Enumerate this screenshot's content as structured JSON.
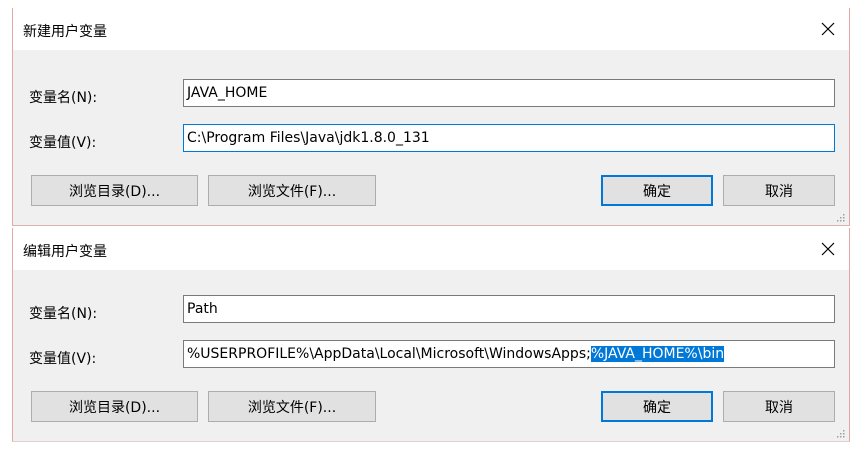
{
  "dialogs": [
    {
      "title": "新建用户变量",
      "name_label": "变量名(N):",
      "name_value": "JAVA_HOME",
      "value_label": "变量值(V):",
      "value_text": "C:\\Program Files\\Java\\jdk1.8.0_131",
      "value_selected": "",
      "browse_dir_label": "浏览目录(D)...",
      "browse_file_label": "浏览文件(F)...",
      "ok_label": "确定",
      "cancel_label": "取消"
    },
    {
      "title": "编辑用户变量",
      "name_label": "变量名(N):",
      "name_value": "Path",
      "value_label": "变量值(V):",
      "value_text": "%USERPROFILE%\\AppData\\Local\\Microsoft\\WindowsApps;",
      "value_selected": "%JAVA_HOME%\\bin",
      "browse_dir_label": "浏览目录(D)...",
      "browse_file_label": "浏览文件(F)...",
      "ok_label": "确定",
      "cancel_label": "取消"
    }
  ],
  "colors": {
    "accent": "#0078d7",
    "dialog_bg": "#f0f0f0",
    "button_bg": "#e1e1e1"
  },
  "icons": [
    "close-icon",
    "resize-grip-icon"
  ]
}
